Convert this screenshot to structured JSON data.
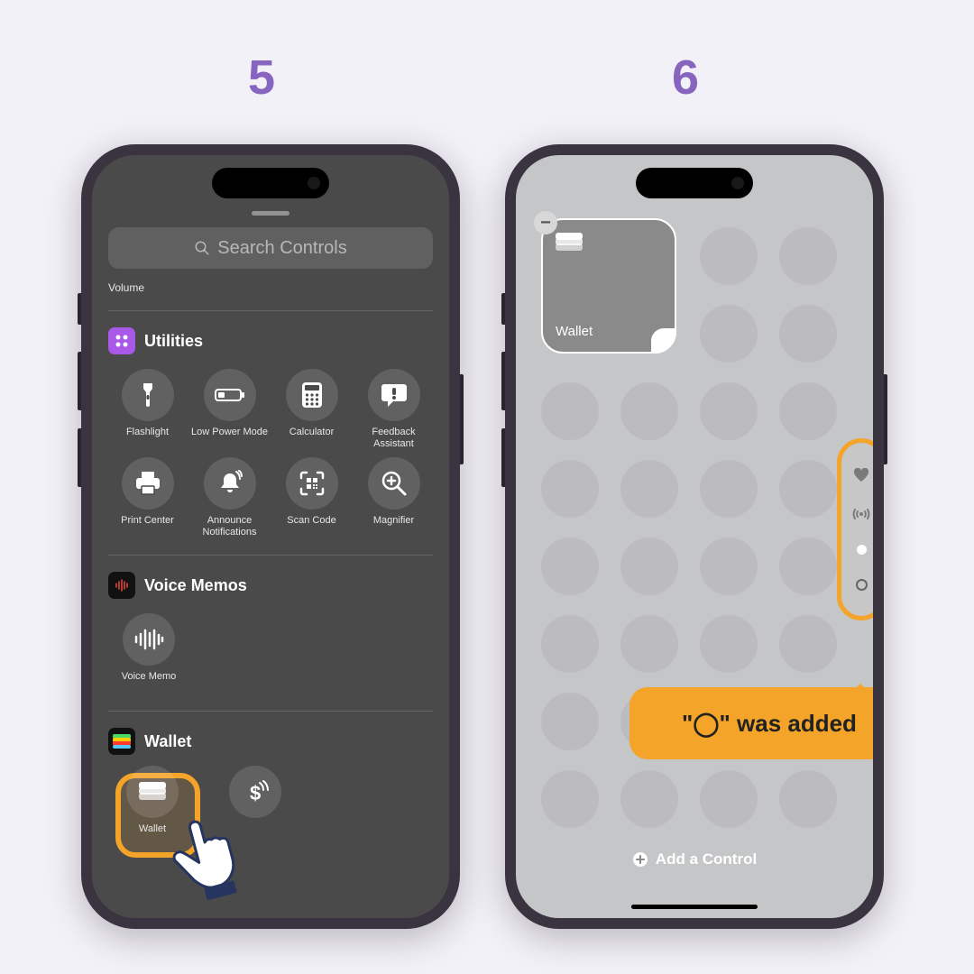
{
  "steps": {
    "left": "5",
    "right": "6"
  },
  "phone1": {
    "search_placeholder": "Search Controls",
    "volume_label": "Volume",
    "utilities_title": "Utilities",
    "items_row1": [
      {
        "label": "Flashlight"
      },
      {
        "label": "Low Power Mode"
      },
      {
        "label": "Calculator"
      },
      {
        "label": "Feedback Assistant"
      }
    ],
    "items_row2": [
      {
        "label": "Print Center"
      },
      {
        "label": "Announce Notifications"
      },
      {
        "label": "Scan Code"
      },
      {
        "label": "Magnifier"
      }
    ],
    "voice_memos_title": "Voice Memos",
    "voice_memo_label": "Voice Memo",
    "wallet_title": "Wallet",
    "wallet_item_label": "Wallet"
  },
  "phone2": {
    "widget_label": "Wallet",
    "add_control": "Add a Control",
    "callout": "\"◯\" was added"
  }
}
